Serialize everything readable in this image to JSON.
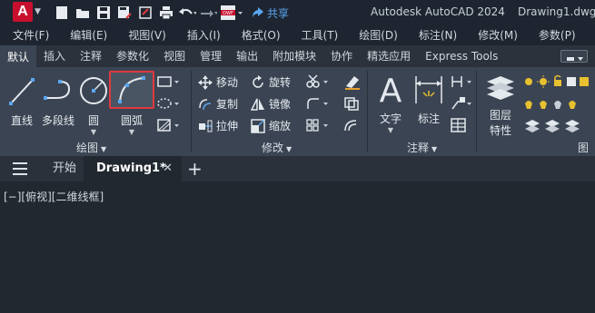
{
  "window": {
    "app_logo": "A",
    "app_title": "Autodesk AutoCAD 2024",
    "file_title": "Drawing1.dwg",
    "share_label": "共享",
    "quick_access_icons": [
      "new-icon",
      "open-icon",
      "save-icon",
      "save-as-icon",
      "publish-icon",
      "print-icon",
      "undo-icon",
      "redo-icon",
      "dwf-icon"
    ]
  },
  "menu": {
    "items": [
      "文件(F)",
      "编辑(E)",
      "视图(V)",
      "插入(I)",
      "格式(O)",
      "工具(T)",
      "绘图(D)",
      "标注(N)",
      "修改(M)",
      "参数(P)"
    ]
  },
  "ribbon_tabs": {
    "items": [
      "默认",
      "插入",
      "注释",
      "参数化",
      "视图",
      "管理",
      "输出",
      "附加模块",
      "协作",
      "精选应用",
      "Express Tools"
    ],
    "active": "默认"
  },
  "ribbon": {
    "draw": {
      "title": "绘图",
      "line": "直线",
      "polyline": "多段线",
      "circle": "圆",
      "arc": "圆弧"
    },
    "modify": {
      "title": "修改",
      "move": "移动",
      "rotate": "旋转",
      "copy": "复制",
      "mirror": "镜像",
      "stretch": "拉伸",
      "scale": "缩放"
    },
    "annotation": {
      "title": "注释",
      "text": "文字",
      "dimension": "标注"
    },
    "layers": {
      "title": "图",
      "properties_line1": "图层",
      "properties_line2": "特性"
    }
  },
  "file_tabs": {
    "start": "开始",
    "active": "Drawing1*",
    "close": "✕",
    "add": "+"
  },
  "canvas": {
    "viewport_label": "[−][俯视][二维线框]"
  },
  "colors": {
    "background": "#212830",
    "ribbon": "#3b4452",
    "highlight": "#e0393e",
    "brand": "#c8102e",
    "share": "#5aa6f0"
  }
}
